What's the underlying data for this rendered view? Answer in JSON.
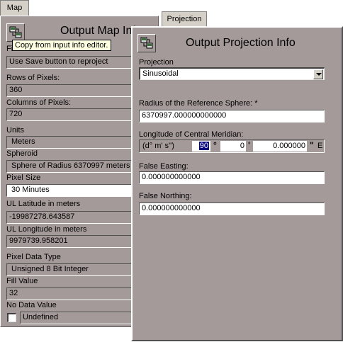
{
  "tabs": {
    "map": "Map",
    "projection": "Projection"
  },
  "map_panel": {
    "title": "Output Map Info",
    "tooltip": "Copy from input info editor.",
    "file_name_label": "File Name",
    "file_name_value": "Use Save button to reproject",
    "rows_label": "Rows of Pixels:",
    "rows_value": "360",
    "columns_label": "Columns of Pixels:",
    "columns_value": "720",
    "units_label": "Units",
    "units_value": "Meters",
    "spheroid_label": "Spheroid",
    "spheroid_value": "Sphere of Radius 6370997 meters",
    "pixel_size_label": "Pixel Size",
    "pixel_size_value": "30 Minutes",
    "ul_lat_label": "UL Latitude in meters",
    "ul_lat_value": "-19987278.643587",
    "ul_lon_label": "UL Longitude in meters",
    "ul_lon_value": "9979739.958201",
    "pixel_type_label": "Pixel Data Type",
    "pixel_type_value": "Unsigned 8 Bit Integer",
    "fill_label": "Fill Value",
    "fill_value": "32",
    "nodata_label": "No Data Value",
    "nodata_value": "Undefined"
  },
  "proj_panel": {
    "title": "Output Projection Info",
    "projection_label": "Projection",
    "projection_value": "Sinusoidal",
    "radius_label": "Radius of the Reference Sphere: *",
    "radius_value": "6370997.000000000000",
    "lcm_label": "Longitude of Central Meridian:",
    "dms_label": "(d° m' s'')",
    "deg_value": "90",
    "min_value": "0",
    "sec_value": "0.000000",
    "deg_sym": "°",
    "min_sym": "'",
    "sec_sym": "\"",
    "hemisphere": "E",
    "false_easting_label": "False Easting:",
    "false_easting_value": "0.000000000000",
    "false_northing_label": "False Northing:",
    "false_northing_value": "0.000000000000"
  }
}
